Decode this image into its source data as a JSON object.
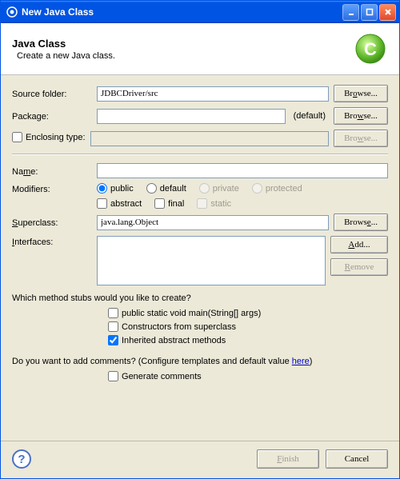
{
  "window": {
    "title": "New Java Class"
  },
  "banner": {
    "heading": "Java Class",
    "subheading": "Create a new Java class."
  },
  "labels": {
    "source_folder": "Source folder:",
    "package": "Package:",
    "enclosing_type": "Enclosing type:",
    "name": "Name:",
    "modifiers": "Modifiers:",
    "superclass": "Superclass:",
    "interfaces": "Interfaces:"
  },
  "fields": {
    "source_folder": "JDBCDriver/src",
    "package": "",
    "package_default": "(default)",
    "enclosing_type": "",
    "name": "",
    "superclass": "java.lang.Object"
  },
  "buttons": {
    "browse": "Browse...",
    "add": "Add...",
    "remove": "Remove",
    "finish": "Finish",
    "cancel": "Cancel"
  },
  "modifiers": {
    "public": "public",
    "default": "default",
    "private": "private",
    "protected": "protected",
    "abstract": "abstract",
    "final": "final",
    "static": "static"
  },
  "stubs": {
    "question": "Which method stubs would you like to create?",
    "main": "public static void main(String[] args)",
    "constructors": "Constructors from superclass",
    "inherited": "Inherited abstract methods"
  },
  "comments": {
    "question_prefix": "Do you want to add comments? (Configure templates and default value ",
    "here": "here",
    "question_suffix": ")",
    "generate": "Generate comments"
  }
}
